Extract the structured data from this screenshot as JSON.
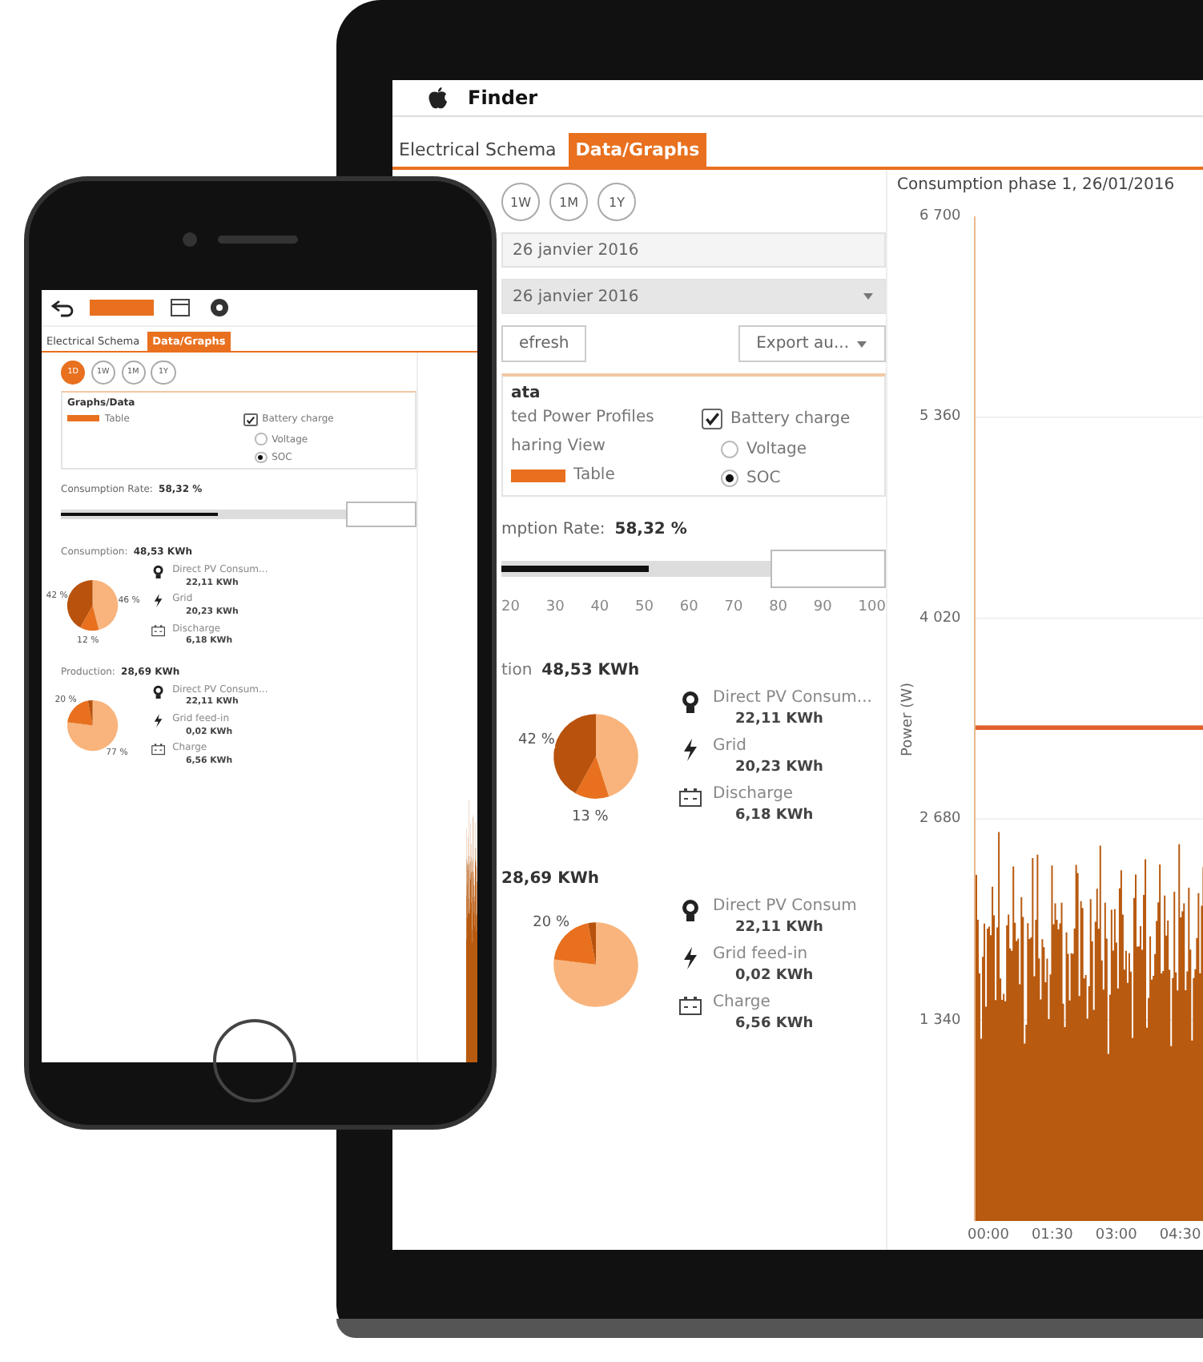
{
  "laptop": {
    "menu_bar": {
      "app": "Finder"
    },
    "tabs": [
      {
        "label": "Electrical Schema",
        "selected": false
      },
      {
        "label": "Data/Graphs",
        "selected": true
      }
    ],
    "period_buttons": [
      {
        "label": "1W",
        "selected": false
      },
      {
        "label": "1M",
        "selected": false
      },
      {
        "label": "1Y",
        "selected": false
      }
    ],
    "date_from": "26 janvier 2016",
    "date_to": "26 janvier 2016",
    "refresh_button": "efresh",
    "export_dropdown": "Export au...",
    "options": {
      "title": "ata",
      "labels": [
        "ted Power Profiles",
        "haring View"
      ],
      "toggle": {
        "label": "Table",
        "on": true
      },
      "battery_charge": {
        "label": "Battery charge",
        "checked": true
      },
      "radios": [
        {
          "label": "Voltage",
          "selected": false
        },
        {
          "label": "SOC",
          "selected": true
        }
      ]
    },
    "rate": {
      "label": "mption Rate:",
      "value": "58,32 %",
      "level": 0.55,
      "ticks": [
        "20",
        "30",
        "40",
        "50",
        "60",
        "70",
        "80",
        "90",
        "100"
      ]
    },
    "summaries": [
      {
        "title": "tion",
        "total": "48,53 KWh",
        "chart_data": {
          "type": "pie",
          "values": [
            45,
            13,
            42
          ],
          "value_labels": [
            null,
            "13 %",
            "42 %"
          ]
        },
        "items": [
          {
            "kind": "bulb",
            "label": "Direct PV Consum...",
            "value": "22,11 KWh"
          },
          {
            "kind": "bolt",
            "label": "Grid",
            "value": "20,23 KWh"
          },
          {
            "kind": "battery",
            "label": "Discharge",
            "value": "6,18 KWh"
          }
        ]
      },
      {
        "total": "28,69 KWh",
        "chart_data": {
          "type": "pie",
          "values": [
            77,
            20,
            3
          ],
          "value_labels": [
            null,
            "20 %",
            null
          ]
        },
        "items": [
          {
            "kind": "bulb",
            "label": "Direct PV Consum",
            "value": "22,11 KWh"
          },
          {
            "kind": "bolt",
            "label": "Grid feed-in",
            "value": "0,02 KWh"
          },
          {
            "kind": "battery",
            "label": "Charge",
            "value": "6,56 KWh"
          }
        ]
      }
    ],
    "chart": {
      "title": "Consumption phase 1, 26/01/2016",
      "ylabel": "Power (W)",
      "yticks": [
        "6 700",
        "5 360",
        "4 020",
        "2 680",
        "1 340"
      ],
      "xticks": [
        "00:00",
        "01:30",
        "03:00",
        "04:30"
      ]
    }
  },
  "phone": {
    "tabs": [
      {
        "label": "Electrical Schema",
        "selected": false
      },
      {
        "label": "Data/Graphs",
        "selected": true
      }
    ],
    "period_buttons": [
      {
        "label": "1D",
        "selected": true
      },
      {
        "label": "1W",
        "selected": false
      },
      {
        "label": "1M",
        "selected": false
      },
      {
        "label": "1Y",
        "selected": false
      }
    ],
    "options": {
      "title": "Graphs/Data",
      "toggle": {
        "label": "Table",
        "on": true
      },
      "battery_charge": {
        "label": "Battery charge",
        "checked": true
      },
      "radios": [
        {
          "label": "Voltage",
          "selected": false
        },
        {
          "label": "SOC",
          "selected": true
        }
      ]
    },
    "rate": {
      "label": "Consumption Rate:",
      "value": "58,32 %",
      "level": 0.55
    },
    "summaries": [
      {
        "title": "Consumption:",
        "total": "48,53 KWh",
        "chart_data": {
          "type": "pie",
          "values": [
            46,
            12,
            42
          ],
          "value_labels": [
            "46 %",
            "12 %",
            "42 %"
          ]
        },
        "items": [
          {
            "kind": "bulb",
            "label": "Direct PV Consum...",
            "value": "22,11 KWh"
          },
          {
            "kind": "bolt",
            "label": "Grid",
            "value": "20,23 KWh"
          },
          {
            "kind": "battery",
            "label": "Discharge",
            "value": "6,18 KWh"
          }
        ]
      },
      {
        "title": "Production:",
        "total": "28,69 KWh",
        "chart_data": {
          "type": "pie",
          "values": [
            77,
            20,
            3
          ],
          "value_labels": [
            "77 %",
            "20 %",
            null
          ]
        },
        "items": [
          {
            "kind": "bulb",
            "label": "Direct PV Consum...",
            "value": "22,11 KWh"
          },
          {
            "kind": "bolt",
            "label": "Grid feed-in",
            "value": "0,02 KWh"
          },
          {
            "kind": "battery",
            "label": "Charge",
            "value": "6,56 KWh"
          }
        ]
      }
    ]
  }
}
